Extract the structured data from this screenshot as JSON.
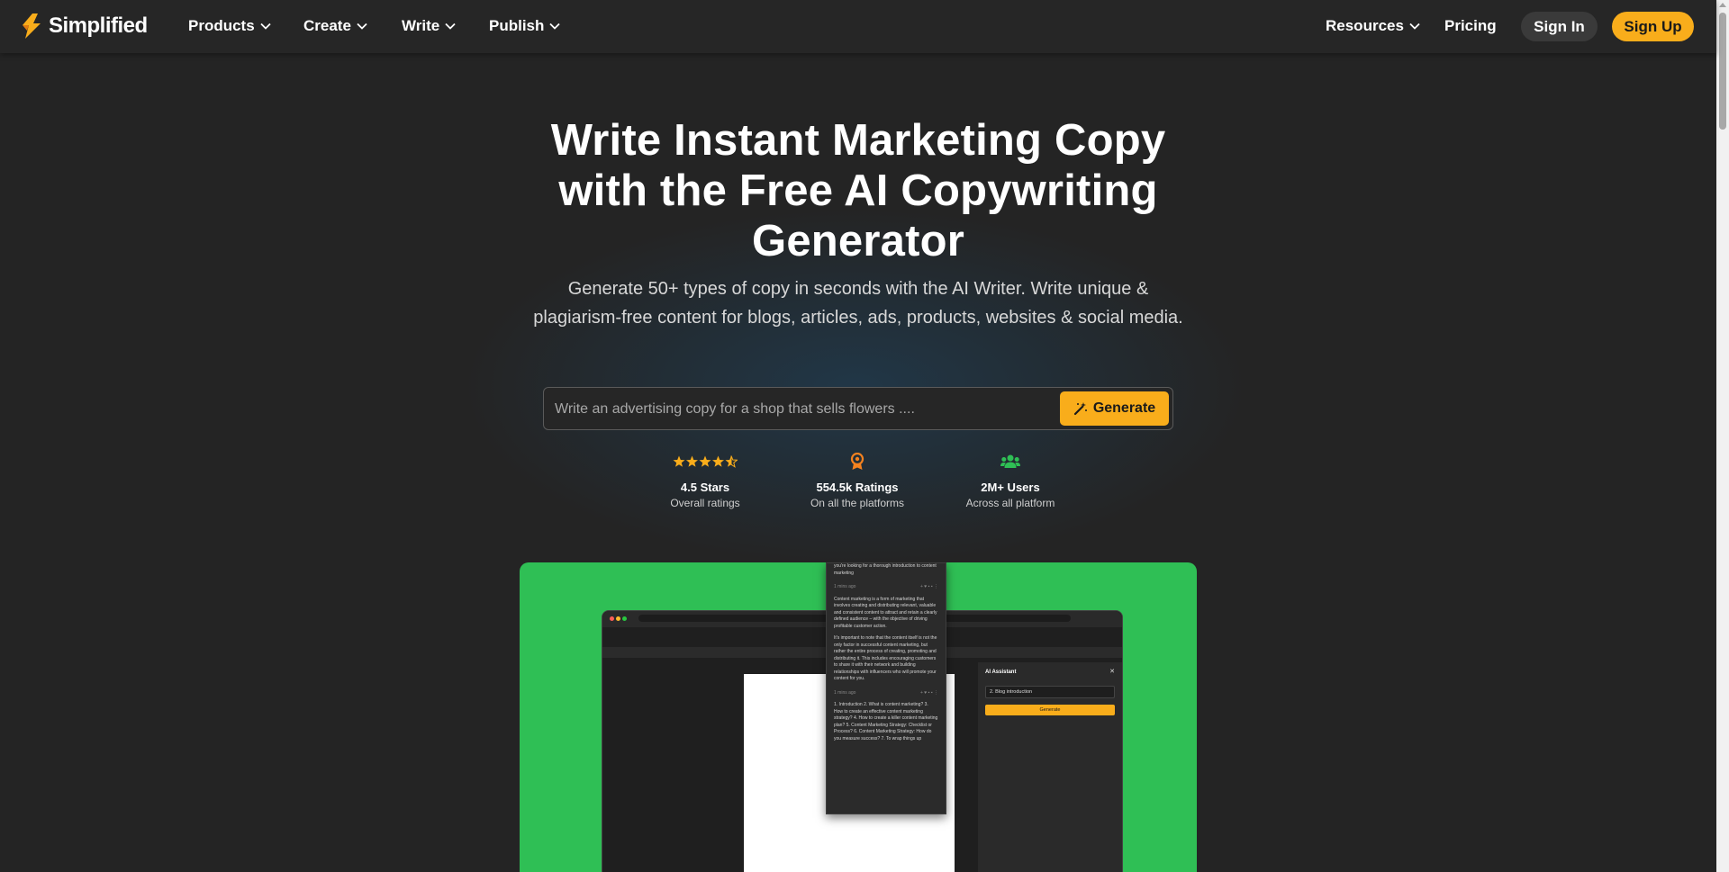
{
  "nav": {
    "brand": "Simplified",
    "items": [
      {
        "label": "Products"
      },
      {
        "label": "Create"
      },
      {
        "label": "Write"
      },
      {
        "label": "Publish"
      }
    ],
    "resources": "Resources",
    "pricing": "Pricing",
    "sign_in": "Sign In",
    "sign_up": "Sign Up"
  },
  "hero": {
    "title": "Write Instant Marketing Copy with the Free AI Copywriting Generator",
    "subtitle": "Generate 50+ types of copy in seconds with the AI Writer. Write unique & plagiarism-free content for blogs, articles, ads, products, websites & social media."
  },
  "search": {
    "placeholder": "Write an advertising copy for a shop that sells flowers ....",
    "button": "Generate"
  },
  "stats": [
    {
      "title": "4.5 Stars",
      "sub": "Overall ratings",
      "icon": "stars-icon"
    },
    {
      "title": "554.5k Ratings",
      "sub": "On all the platforms",
      "icon": "award-icon"
    },
    {
      "title": "2M+ Users",
      "sub": "Across all platform",
      "icon": "users-icon"
    }
  ],
  "preview": {
    "ai_title": "AI Assistant",
    "ai_select": "2. Blog introduction",
    "ai_generate": "Generate",
    "card_top": "you're looking for a thorough introduction to content marketing",
    "card_para1": "Content marketing is a form of marketing that involves creating and distributing relevant, valuable and consistent content to attract and retain a clearly defined audience – with the objective of driving profitable customer action.",
    "card_para2": "It's important to note that the content itself is not the only factor in successful content marketing, but rather the entire process of creating, promoting and distributing it. This includes encouraging customers to share it with their network and building relationships with influencers who will promote your content for you.",
    "card_list": "1. Introduction 2. What is content marketing? 3. How to create an effective content marketing strategy? 4. How to create a killer content marketing plan? 5. Content Marketing Strategy: Checklist or Process? 6. Content Marketing Strategy: How do you measure success? 7. To wrap things up",
    "time_1": "1 mins ago",
    "time_2": "1 mins ago"
  },
  "colors": {
    "accent": "#f9ad1b",
    "green": "#2fbf55",
    "background": "#242424"
  }
}
